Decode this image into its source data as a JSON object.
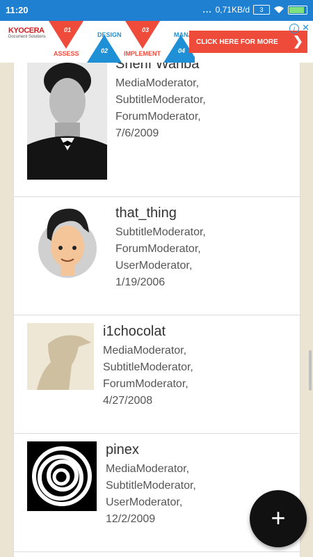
{
  "status_bar": {
    "time": "11:20",
    "dots": "...",
    "speed": "0,71KB/d",
    "sim": "3",
    "battery_level": 0.95
  },
  "ad": {
    "brand": "KYOCERA",
    "brand_tag": "Document Solutions",
    "steps": [
      {
        "num": "01",
        "label": "ASSESS"
      },
      {
        "num": "02",
        "label": "DESIGN"
      },
      {
        "num": "03",
        "label": "IMPLEMENT"
      },
      {
        "num": "04",
        "label": "MANA"
      }
    ],
    "cta": "CLICK HERE FOR MORE",
    "info": "i",
    "close": "✕"
  },
  "users": [
    {
      "name": "Sherif Wahba",
      "roles": [
        "MediaModerator,",
        "SubtitleModerator,",
        "ForumModerator,"
      ],
      "date": "7/6/2009"
    },
    {
      "name": "that_thing",
      "roles": [
        "SubtitleModerator,",
        "ForumModerator,",
        "UserModerator,"
      ],
      "date": "1/19/2006"
    },
    {
      "name": "i1chocolat",
      "roles": [
        "MediaModerator,",
        "SubtitleModerator,",
        "ForumModerator,"
      ],
      "date": "4/27/2008"
    },
    {
      "name": "pinex",
      "roles": [
        "MediaModerator,",
        "SubtitleModerator,",
        "UserModerator,"
      ],
      "date": "12/2/2009"
    }
  ],
  "fab": {
    "label": "+"
  }
}
